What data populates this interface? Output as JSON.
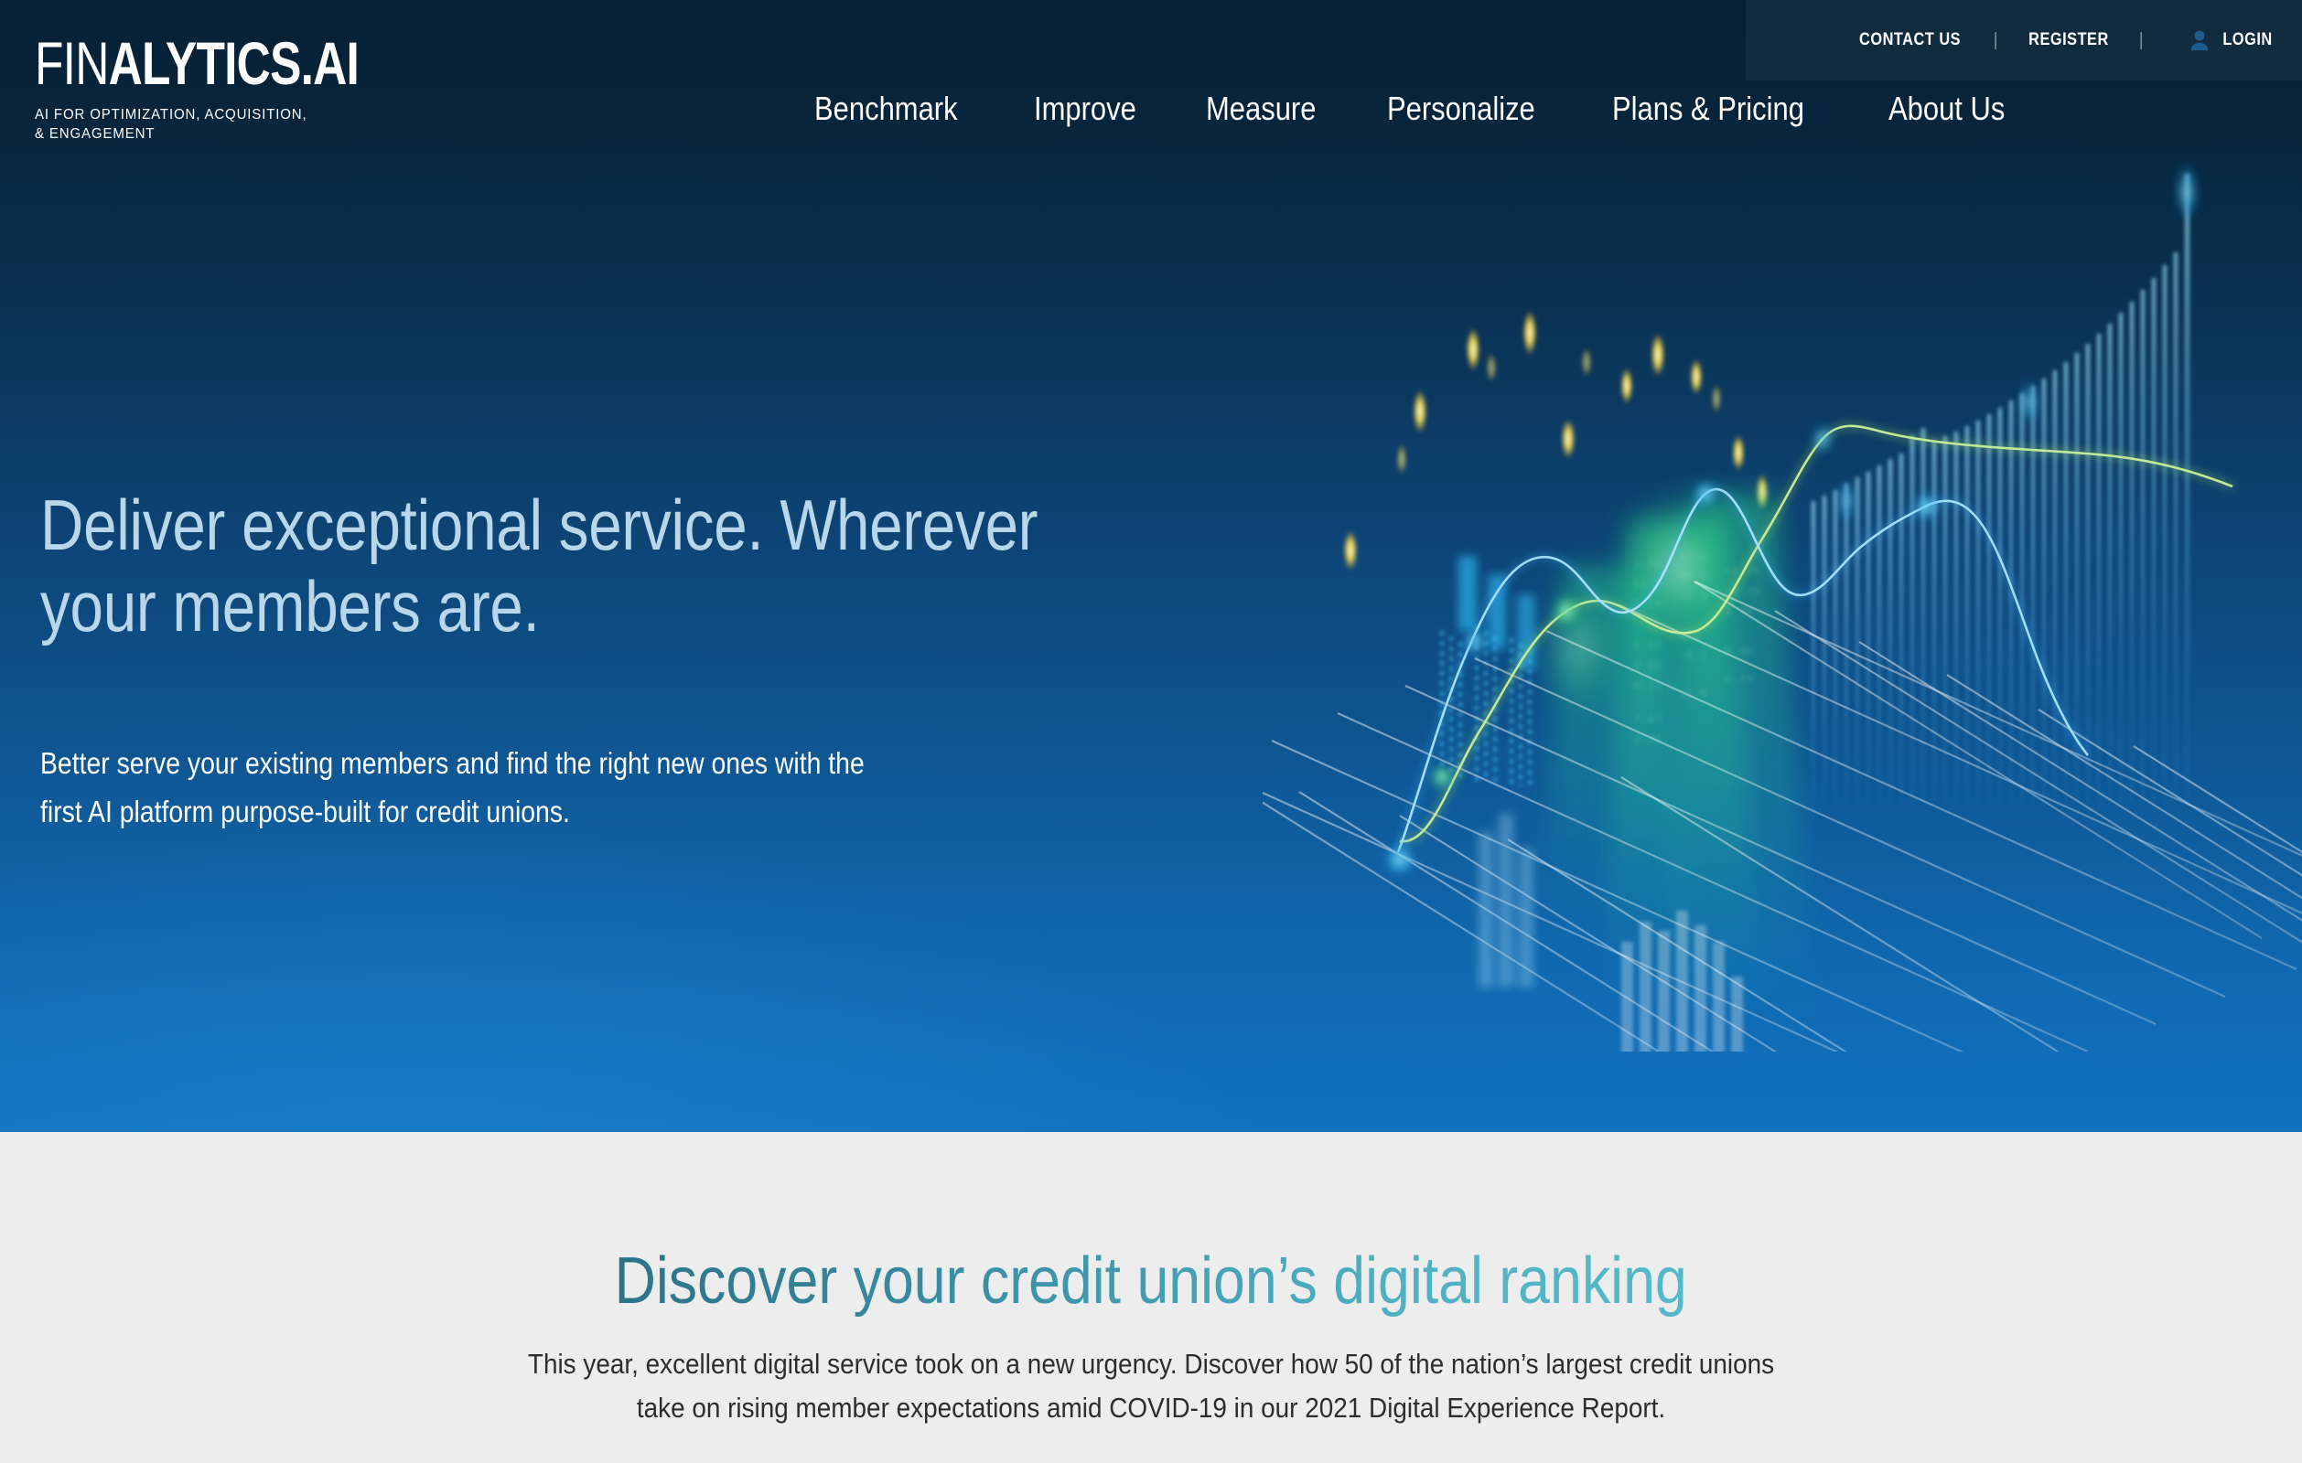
{
  "brand": {
    "logo_prefix": "FIN",
    "logo_suffix": "ALYTICS.AI",
    "tagline": "AI FOR OPTIMIZATION, ACQUISITION,\n& ENGAGEMENT"
  },
  "topbar": {
    "contact_label": "CONTACT US",
    "separator": "|",
    "register_label": "REGISTER",
    "login_label": "LOGIN",
    "login_icon": "person-icon"
  },
  "nav": {
    "items": [
      {
        "label": "Benchmark"
      },
      {
        "label": "Improve"
      },
      {
        "label": "Measure"
      },
      {
        "label": "Personalize"
      },
      {
        "label": "Plans & Pricing"
      },
      {
        "label": "About Us"
      }
    ]
  },
  "hero": {
    "heading": "Deliver exceptional service. Wherever\nyour members are.",
    "body": "Better serve your existing members and find the right new ones with the\nfirst AI platform purpose-built for credit unions.",
    "graphic_name": "3d-analytics-visualization"
  },
  "section_ranking": {
    "heading": "Discover your credit union’s digital ranking",
    "body": "This year, excellent digital service took on a new urgency. Discover how 50 of the nation’s largest credit unions\ntake on rising member expectations amid COVID-19 in our 2021 Digital Experience Report."
  },
  "colors": {
    "hero_top": "#072135",
    "hero_bottom": "#1171bd",
    "heading_tint": "#b9d7ea",
    "teal_dark": "#2c7389",
    "teal_light": "#55b9c9",
    "page_bg": "#ededed",
    "accent_cyan": "#35c6f4",
    "accent_green": "#3fd38a",
    "accent_yellow": "#f3d84f"
  },
  "chart_data": {
    "type": "line",
    "title": "",
    "xlabel": "",
    "ylabel": "",
    "grid": true,
    "legend": "none",
    "description": "Decorative 3D perspective analytics surface: receding rhombus grid plane with two overlaid trend lines, a rising column histogram, floating candlestick markers and glowing data columns.",
    "series": [
      {
        "name": "cyan-trend",
        "color": "#4fc3f7",
        "values": [
          4,
          10,
          30,
          52,
          60,
          50,
          44,
          62,
          78,
          60,
          44,
          40,
          52,
          62,
          56,
          48,
          58,
          70,
          66,
          52,
          34,
          20,
          14
        ]
      },
      {
        "name": "green-trend",
        "color": "#8fd97a",
        "values": [
          2,
          4,
          8,
          16,
          30,
          44,
          48,
          42,
          38,
          44,
          52,
          58,
          66,
          74,
          80,
          84,
          86,
          86,
          85,
          84,
          82,
          76,
          70
        ]
      }
    ],
    "bars": {
      "name": "rising-histogram",
      "color": "#5ac8f0",
      "values": [
        20,
        22,
        26,
        28,
        31,
        34,
        36,
        40,
        42,
        46,
        49,
        52,
        54,
        52,
        54,
        57,
        59,
        62,
        64,
        67,
        70,
        72,
        75,
        78,
        80,
        83,
        85,
        88,
        90,
        93,
        95,
        98,
        100
      ]
    },
    "markers": {
      "name": "candlesticks",
      "color": "#f3d84f",
      "count": 22
    }
  }
}
